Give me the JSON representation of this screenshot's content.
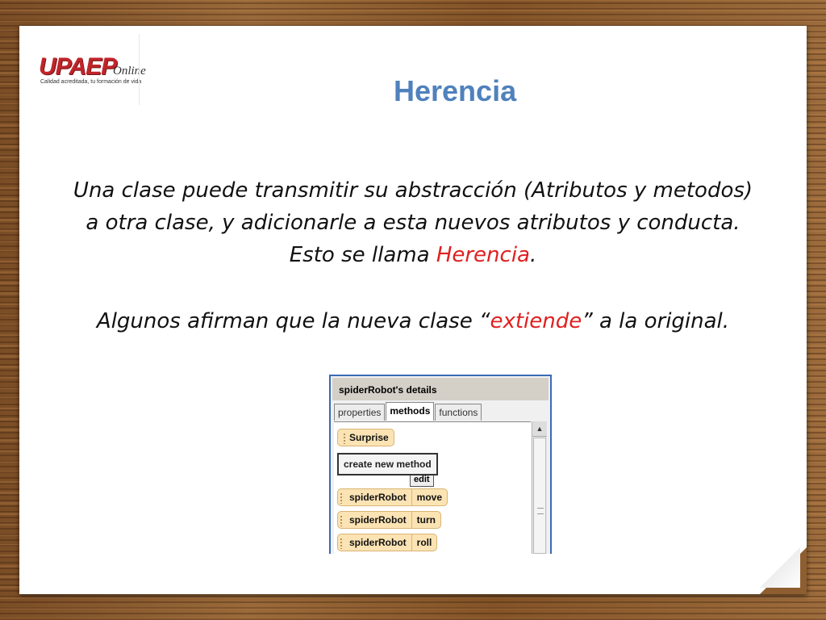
{
  "logo": {
    "brand": "UPAEP",
    "suffix": "Online",
    "tagline": "Calidad acreditada, tu formación de vida"
  },
  "slide": {
    "title": "Herencia",
    "para1_a": "Una clase puede transmitir su abstracción (Atributos y metodos) a otra clase, y adicionarle a esta nuevos atributos y conducta.  Esto se llama ",
    "para1_highlight": "Herencia",
    "para1_end": ".",
    "para2_a": "Algunos afirman que la nueva clase “",
    "para2_highlight": "extiende",
    "para2_end": "” a la original."
  },
  "details_panel": {
    "header": "spiderRobot's details",
    "tabs": [
      "properties",
      "methods",
      "functions"
    ],
    "active_tab": "methods",
    "surprise_method": "Surprise",
    "edit_button": "edit",
    "create_button": "create new method",
    "methods": [
      {
        "object": "spiderRobot",
        "name": "move"
      },
      {
        "object": "spiderRobot",
        "name": "turn"
      },
      {
        "object": "spiderRobot",
        "name": "roll"
      }
    ]
  },
  "colors": {
    "title": "#4f81bd",
    "highlight": "#e02020",
    "logo_red": "#c0252a"
  }
}
